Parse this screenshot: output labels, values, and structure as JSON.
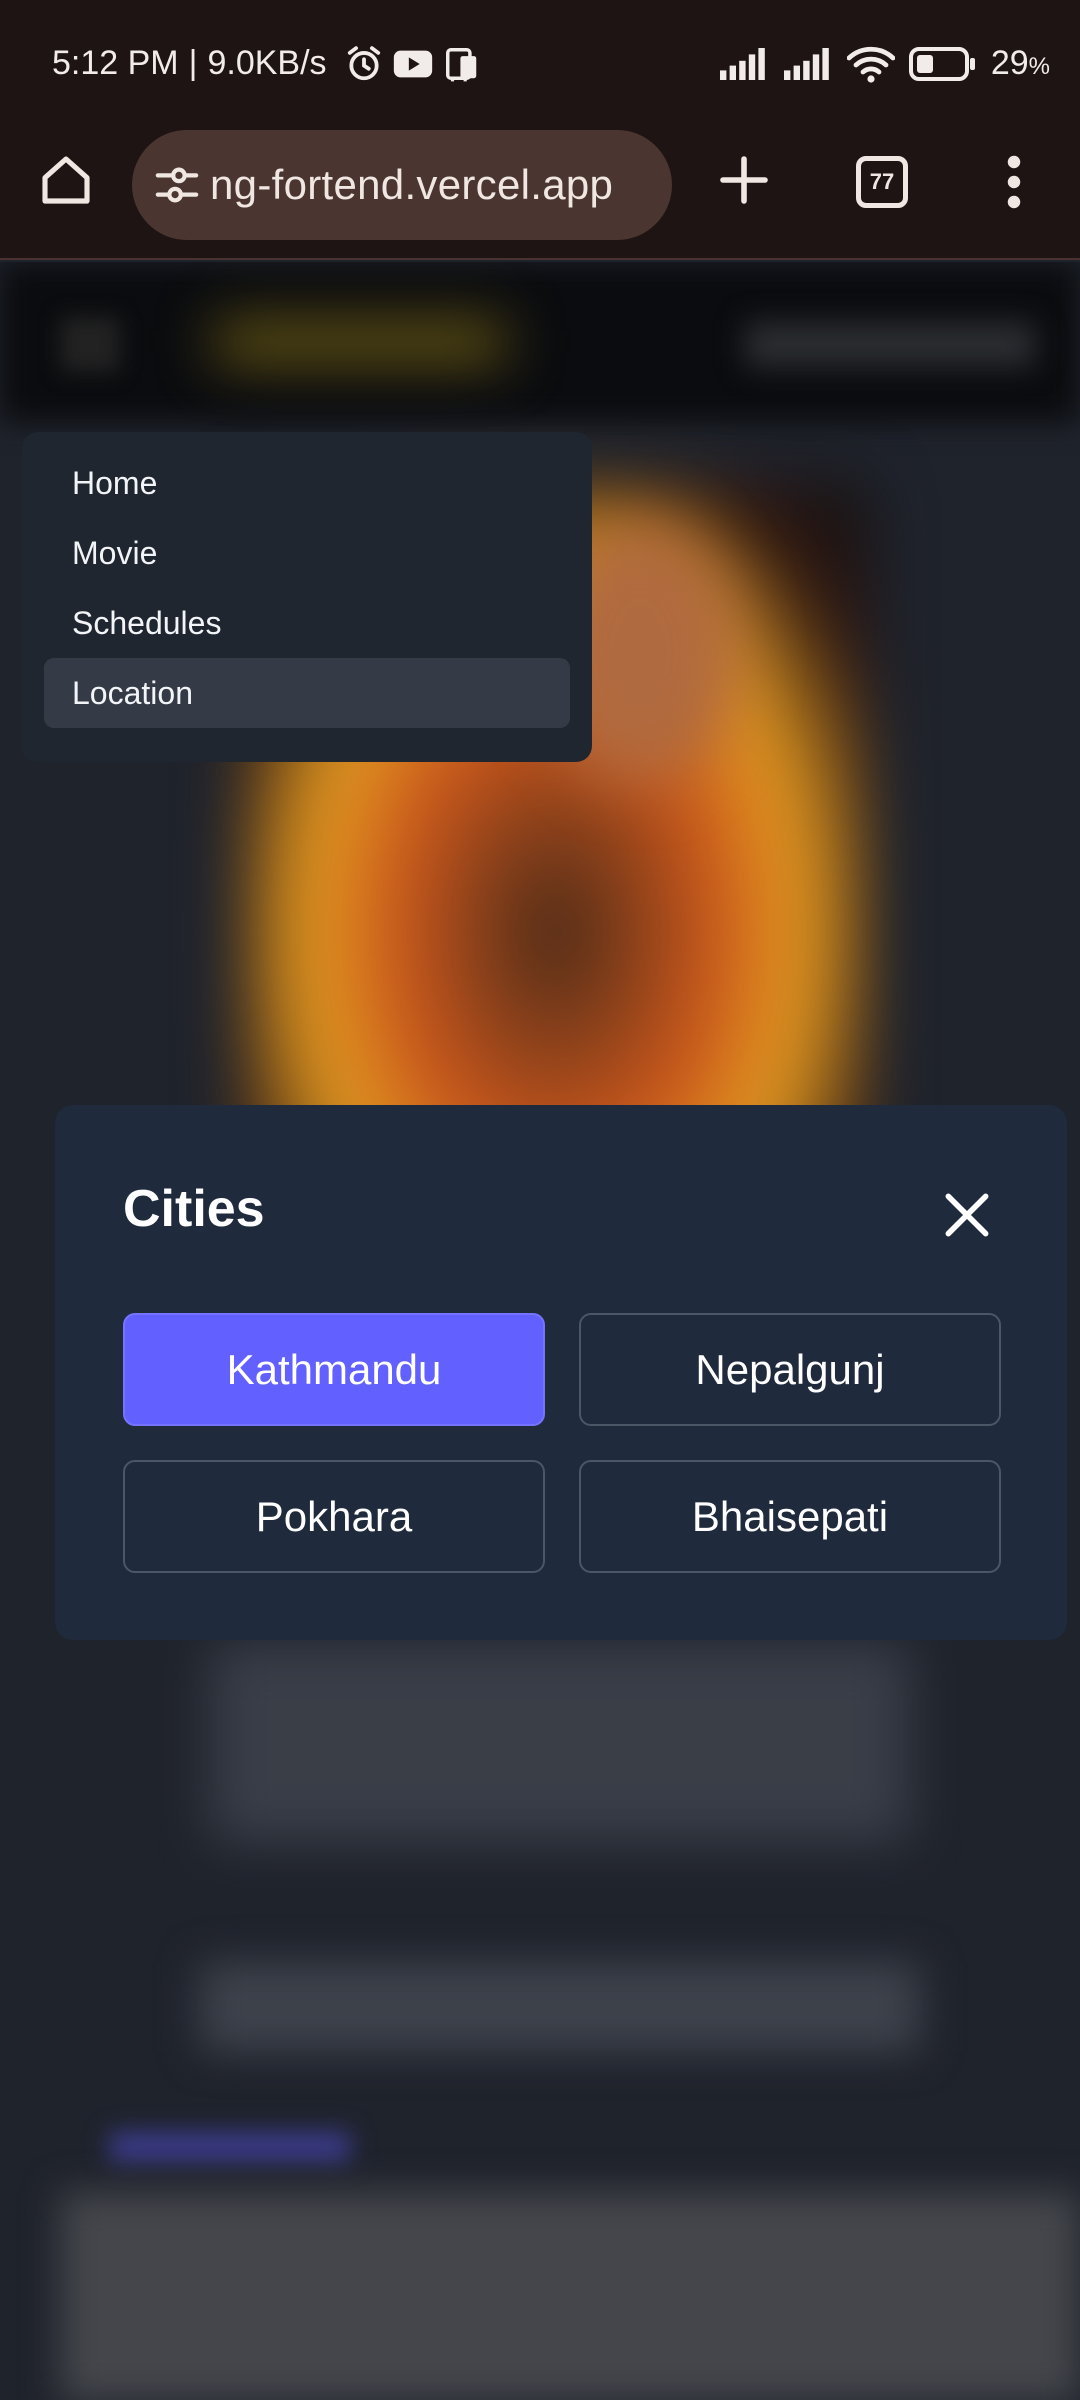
{
  "status_bar": {
    "time": "5:12 PM",
    "network_speed": "9.0KB/s",
    "battery": "29",
    "battery_unit": "%"
  },
  "browser": {
    "url": "ng-fortend.vercel.app",
    "tab_count": "77"
  },
  "nav_menu": {
    "items": [
      {
        "label": "Home",
        "active": false
      },
      {
        "label": "Movie",
        "active": false
      },
      {
        "label": "Schedules",
        "active": false
      },
      {
        "label": "Location",
        "active": true
      }
    ]
  },
  "cities_modal": {
    "title": "Cities",
    "cities": [
      {
        "label": "Kathmandu",
        "selected": true
      },
      {
        "label": "Nepalgunj",
        "selected": false
      },
      {
        "label": "Pokhara",
        "selected": false
      },
      {
        "label": "Bhaisepati",
        "selected": false
      }
    ],
    "accent_color": "#6260ff"
  }
}
